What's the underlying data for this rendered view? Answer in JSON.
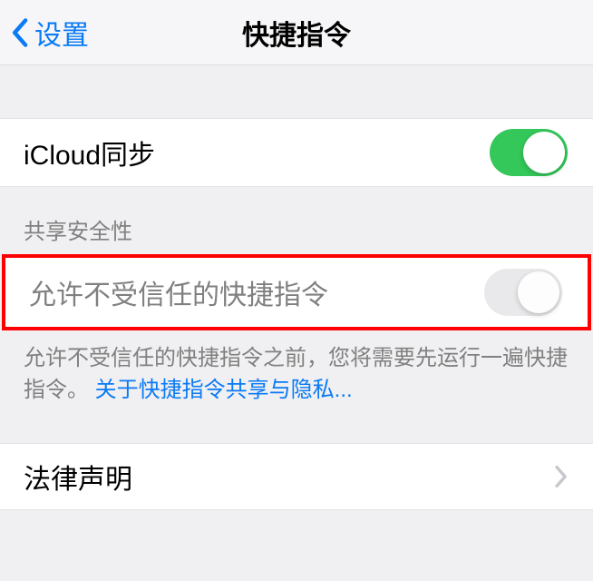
{
  "nav": {
    "back_label": "设置",
    "title": "快捷指令"
  },
  "icloud_row": {
    "label": "iCloud同步",
    "toggle": true
  },
  "sharing_section": {
    "header": "共享安全性"
  },
  "untrusted_row": {
    "label": "允许不受信任的快捷指令",
    "toggle": false
  },
  "footer": {
    "text_prefix": "允许不受信任的快捷指令之前，您将需要先运行一遍快捷指令。",
    "link_text": "关于快捷指令共享与隐私..."
  },
  "legal_row": {
    "label": "法律声明"
  }
}
